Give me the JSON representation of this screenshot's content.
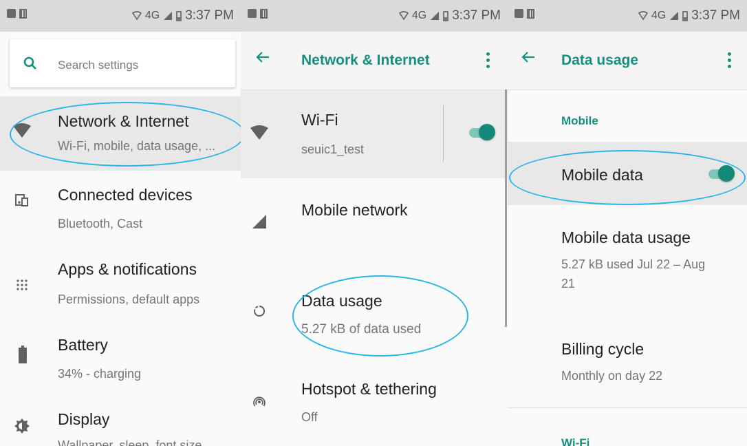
{
  "status_bar": {
    "network": "4G",
    "time": "3:37 PM"
  },
  "settings": {
    "search_placeholder": "Search settings",
    "items": [
      {
        "title": "Network & Internet",
        "subtitle": "Wi-Fi, mobile, data usage, ...",
        "icon": "wifi-icon"
      },
      {
        "title": "Connected devices",
        "subtitle": "Bluetooth, Cast",
        "icon": "devices-icon"
      },
      {
        "title": "Apps & notifications",
        "subtitle": "Permissions, default apps",
        "icon": "apps-icon"
      },
      {
        "title": "Battery",
        "subtitle": "34% - charging",
        "icon": "battery-icon"
      },
      {
        "title": "Display",
        "subtitle": "Wallpaper, sleep, font size",
        "icon": "brightness-icon"
      }
    ]
  },
  "network": {
    "title": "Network & Internet",
    "items": [
      {
        "title": "Wi-Fi",
        "subtitle": "seuic1_test",
        "icon": "wifi-icon",
        "toggle": true
      },
      {
        "title": "Mobile network",
        "subtitle": "",
        "icon": "signal-icon"
      },
      {
        "title": "Data usage",
        "subtitle": "5.27 kB of data used",
        "icon": "data-usage-icon"
      },
      {
        "title": "Hotspot & tethering",
        "subtitle": "Off",
        "icon": "hotspot-icon"
      }
    ]
  },
  "data_usage": {
    "title": "Data usage",
    "section_mobile": "Mobile",
    "mobile_data": {
      "title": "Mobile data",
      "toggle": true
    },
    "mobile_data_usage": {
      "title": "Mobile data usage",
      "subtitle_line1": "5.27 kB used Jul 22 – Aug",
      "subtitle_line2": "21"
    },
    "billing_cycle": {
      "title": "Billing cycle",
      "subtitle": "Monthly on day 22"
    },
    "section_wifi": "Wi-Fi"
  },
  "colors": {
    "accent": "#158f7e",
    "highlight": "#2ab5e8",
    "statusbar": "#dadada"
  }
}
